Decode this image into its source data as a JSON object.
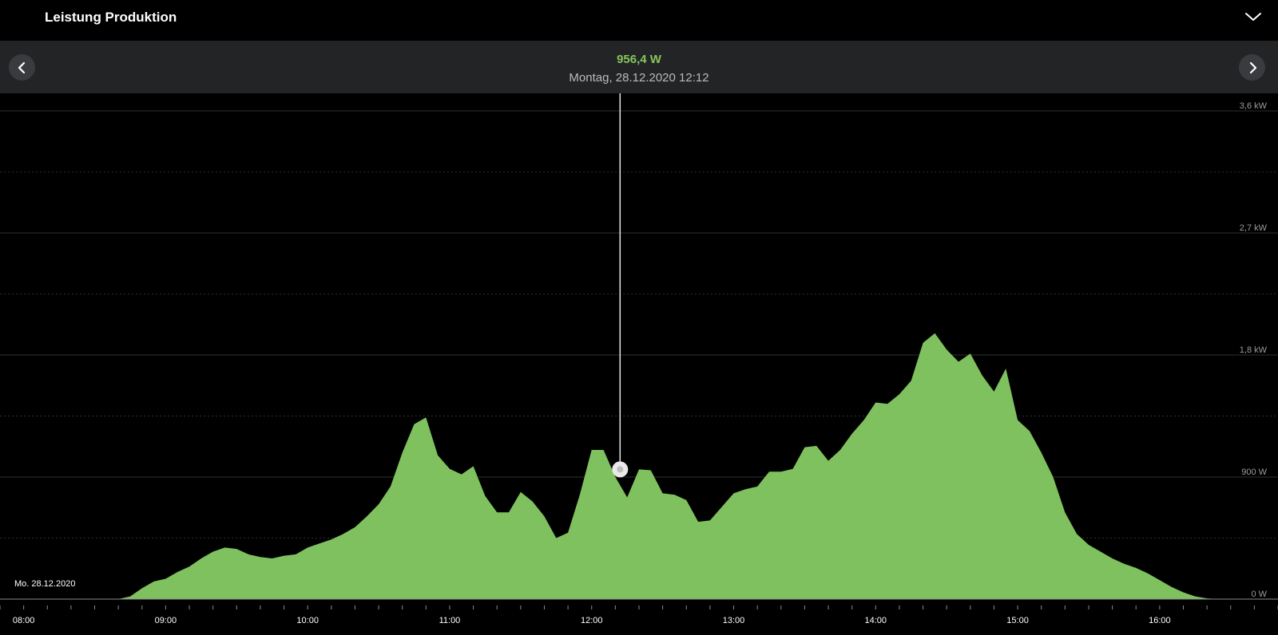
{
  "header": {
    "title": "Leistung Produktion",
    "toggle_icon": "chevron-down-icon"
  },
  "navigation": {
    "prev_icon": "chevron-left-icon",
    "next_icon": "chevron-right-icon"
  },
  "tooltip": {
    "value": "956,4 W",
    "timestamp": "Montag, 28.12.2020 12:12"
  },
  "date_label": "Mo. 28.12.2020",
  "colors": {
    "fill": "#7fc15e",
    "value_text": "#86c55c",
    "background": "#000000",
    "nav_background": "#232426"
  },
  "chart_data": {
    "type": "area",
    "title": "Leistung Produktion",
    "xlabel": "",
    "ylabel": "",
    "y_unit": "W",
    "ylim": [
      0,
      3600
    ],
    "grid": true,
    "y_ticks": [
      {
        "value": 0,
        "label": "0  W"
      },
      {
        "value": 900,
        "label": "900  W"
      },
      {
        "value": 1800,
        "label": "1,8  kW"
      },
      {
        "value": 2700,
        "label": "2,7  kW"
      },
      {
        "value": 3600,
        "label": "3,6  kW"
      }
    ],
    "x_ticks": [
      "08:00",
      "09:00",
      "10:00",
      "11:00",
      "12:00",
      "13:00",
      "14:00",
      "15:00",
      "16:00"
    ],
    "xlim": [
      "07:50",
      "16:50"
    ],
    "cursor": {
      "time": "12:12",
      "value": 956.4
    },
    "series": [
      {
        "values": [
          [
            "08:40",
            0
          ],
          [
            "08:45",
            20
          ],
          [
            "08:50",
            80
          ],
          [
            "08:55",
            130
          ],
          [
            "09:00",
            150
          ],
          [
            "09:05",
            200
          ],
          [
            "09:10",
            240
          ],
          [
            "09:15",
            300
          ],
          [
            "09:20",
            350
          ],
          [
            "09:25",
            380
          ],
          [
            "09:30",
            370
          ],
          [
            "09:35",
            330
          ],
          [
            "09:40",
            310
          ],
          [
            "09:45",
            300
          ],
          [
            "09:50",
            320
          ],
          [
            "09:55",
            330
          ],
          [
            "10:00",
            380
          ],
          [
            "10:05",
            410
          ],
          [
            "10:10",
            440
          ],
          [
            "10:15",
            480
          ],
          [
            "10:20",
            530
          ],
          [
            "10:25",
            610
          ],
          [
            "10:30",
            700
          ],
          [
            "10:35",
            830
          ],
          [
            "10:40",
            1080
          ],
          [
            "10:45",
            1290
          ],
          [
            "10:50",
            1340
          ],
          [
            "10:55",
            1060
          ],
          [
            "11:00",
            960
          ],
          [
            "11:05",
            920
          ],
          [
            "11:10",
            980
          ],
          [
            "11:15",
            760
          ],
          [
            "11:20",
            640
          ],
          [
            "11:25",
            640
          ],
          [
            "11:30",
            790
          ],
          [
            "11:35",
            720
          ],
          [
            "11:40",
            610
          ],
          [
            "11:45",
            450
          ],
          [
            "11:50",
            490
          ],
          [
            "11:55",
            770
          ],
          [
            "12:00",
            1100
          ],
          [
            "12:05",
            1100
          ],
          [
            "12:10",
            900
          ],
          [
            "12:15",
            750
          ],
          [
            "12:20",
            956.4
          ],
          [
            "12:25",
            950
          ],
          [
            "12:30",
            780
          ],
          [
            "12:35",
            770
          ],
          [
            "12:40",
            730
          ],
          [
            "12:45",
            570
          ],
          [
            "12:50",
            580
          ],
          [
            "12:55",
            680
          ],
          [
            "13:00",
            780
          ],
          [
            "13:05",
            810
          ],
          [
            "13:10",
            830
          ],
          [
            "13:15",
            940
          ],
          [
            "13:20",
            940
          ],
          [
            "13:25",
            960
          ],
          [
            "13:30",
            1120
          ],
          [
            "13:35",
            1130
          ],
          [
            "13:40",
            1020
          ],
          [
            "13:45",
            1100
          ],
          [
            "13:50",
            1220
          ],
          [
            "13:55",
            1320
          ],
          [
            "14:00",
            1450
          ],
          [
            "14:05",
            1440
          ],
          [
            "14:10",
            1510
          ],
          [
            "14:15",
            1610
          ],
          [
            "14:20",
            1890
          ],
          [
            "14:25",
            1960
          ],
          [
            "14:30",
            1840
          ],
          [
            "14:35",
            1750
          ],
          [
            "14:40",
            1810
          ],
          [
            "14:45",
            1650
          ],
          [
            "14:50",
            1530
          ],
          [
            "14:55",
            1700
          ],
          [
            "15:00",
            1320
          ],
          [
            "15:05",
            1240
          ],
          [
            "15:10",
            1080
          ],
          [
            "15:15",
            900
          ],
          [
            "15:20",
            640
          ],
          [
            "15:25",
            480
          ],
          [
            "15:30",
            400
          ],
          [
            "15:35",
            350
          ],
          [
            "15:40",
            300
          ],
          [
            "15:45",
            260
          ],
          [
            "15:50",
            230
          ],
          [
            "15:55",
            190
          ],
          [
            "16:00",
            140
          ],
          [
            "16:05",
            90
          ],
          [
            "16:10",
            50
          ],
          [
            "16:15",
            20
          ],
          [
            "16:20",
            5
          ],
          [
            "16:25",
            0
          ]
        ]
      }
    ]
  }
}
